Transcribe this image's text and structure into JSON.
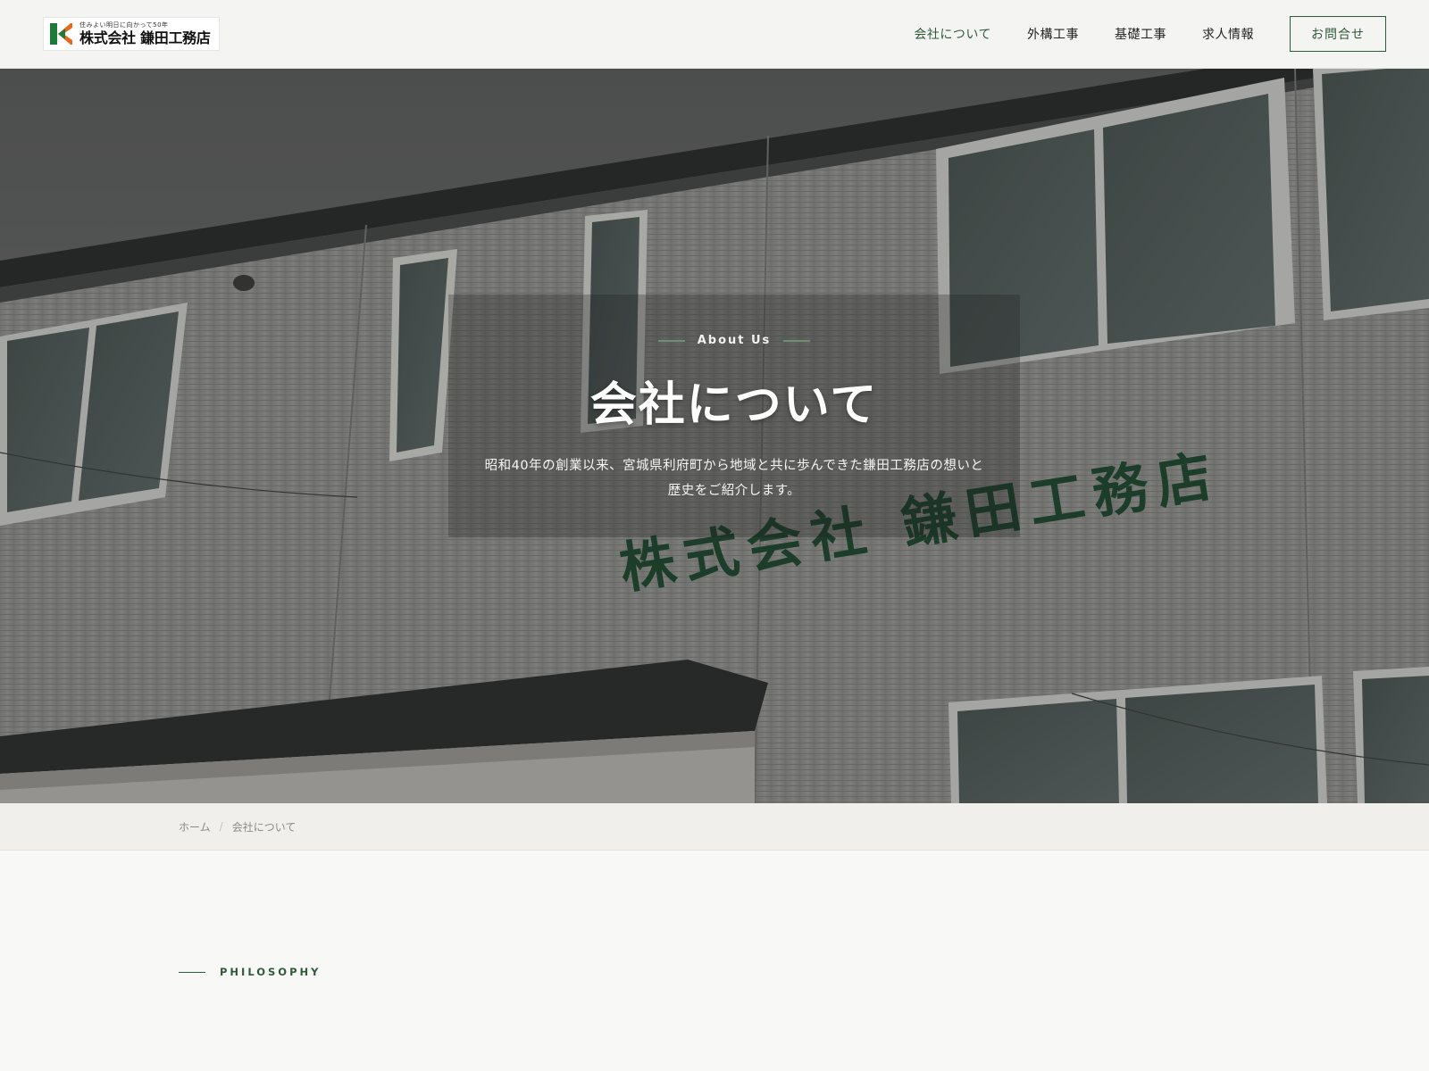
{
  "header": {
    "logo": {
      "tagline": "住みよい明日に向かって50年",
      "name": "株式会社 鎌田工務店"
    },
    "nav": [
      {
        "label": "会社について",
        "active": true
      },
      {
        "label": "外構工事",
        "active": false
      },
      {
        "label": "基礎工事",
        "active": false
      },
      {
        "label": "求人情報",
        "active": false
      }
    ],
    "contact_label": "お問合せ"
  },
  "hero": {
    "eyebrow": "About Us",
    "title": "会社について",
    "description": "昭和40年の創業以来、宮城県利府町から地域と共に歩んできた鎌田工務店の想いと歴史をご紹介します。",
    "building_sign": "株式会社 鎌田工務店"
  },
  "breadcrumb": {
    "home": "ホーム",
    "separator": "/",
    "current": "会社について"
  },
  "philosophy": {
    "label": "PHILOSOPHY"
  },
  "colors": {
    "accent": "#2f5a3a",
    "header_bg": "#f4f4f2",
    "page_bg": "#f8f8f6",
    "breadcrumb_bg": "#f0efeb",
    "logo_orange": "#e56a1c",
    "logo_green": "#1e7a3a"
  },
  "icons": {
    "logo_mark": "k-logo-mark"
  }
}
